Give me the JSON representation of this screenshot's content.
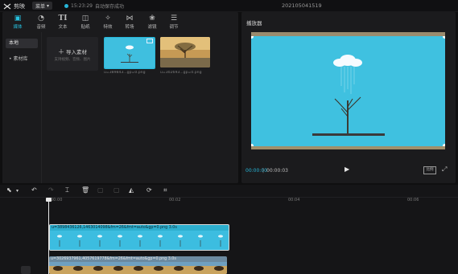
{
  "topbar": {
    "app_name": "剪映",
    "menu_label": "菜单",
    "status_time": "15:23:29",
    "status_text": "自动保存成功",
    "project_title": "202105041519"
  },
  "toolbar": {
    "tools": [
      {
        "label": "媒体",
        "icon": "media-icon",
        "active": true
      },
      {
        "label": "音频",
        "icon": "audio-icon"
      },
      {
        "label": "文本",
        "icon": "text-icon"
      },
      {
        "label": "贴纸",
        "icon": "sticker-icon"
      },
      {
        "label": "特效",
        "icon": "effects-icon"
      },
      {
        "label": "转场",
        "icon": "transition-icon"
      },
      {
        "label": "滤镜",
        "icon": "filter-icon"
      },
      {
        "label": "调节",
        "icon": "adjust-icon"
      }
    ]
  },
  "side_nav": {
    "items": [
      {
        "label": "本地",
        "active": true
      },
      {
        "label": "• 素材库"
      }
    ]
  },
  "media": {
    "import_label": "导入素材",
    "import_hint": "支持视频、音频、图片",
    "thumbnails": [
      {
        "caption": "u=389843...gp=0.png"
      },
      {
        "caption": "u=302693...gp=0.png"
      }
    ]
  },
  "player": {
    "title": "播放器",
    "time_current": "00:00:00",
    "time_separator": "|",
    "time_total": "00:00:03",
    "ratio_label": "比例"
  },
  "timeline": {
    "ruler_labels": [
      "00:00",
      "00:02",
      "00:04",
      "00:06"
    ],
    "track1": {
      "caption": "u=3898436126,1463014098&fm=26&fmt=auto&gp=0.png   3.0s"
    },
    "track2": {
      "caption": "u=3026937961,4057619778&fm=26&fmt=auto&gp=0.png   3.0s"
    }
  },
  "colors": {
    "accent": "#27b6d8",
    "preview_sky": "#3fbfdf",
    "panel_bg": "#1b1b1d"
  }
}
